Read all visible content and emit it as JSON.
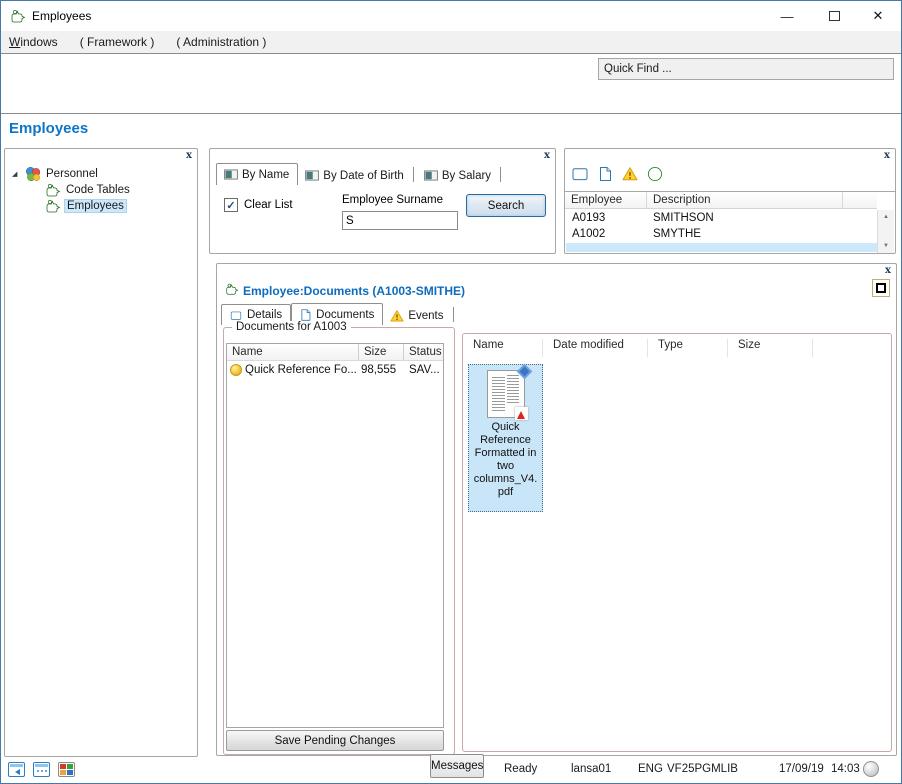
{
  "colors": {
    "accent_blue": "#0e76c8",
    "title_blue": "#0d6cbd",
    "selection_blue": "#cde8fa",
    "warning_yellow": "#ffd22e",
    "add_green": "#3fae49",
    "lansa_green": "#3e9b3e",
    "group_border": "#c9a8a8"
  },
  "title_bar": {
    "app_icon": "lansa-green-icon",
    "title": "Employees"
  },
  "window_controls": {
    "minimize_glyph": "—",
    "maximize_icon": "maximize-icon",
    "close_glyph": "✕"
  },
  "menu_bar": {
    "items": [
      "Windows",
      "( Framework )",
      "( Administration )"
    ]
  },
  "command_bar": {
    "quick_find": "Quick Find ..."
  },
  "heading": "Employees",
  "nav_tree": {
    "close_glyph": "x",
    "expander_glyph": "◢",
    "root": {
      "label": "Personnel",
      "icon": "personnel-icon"
    },
    "items": [
      {
        "label": "Code Tables",
        "icon": "lansa-green-icon"
      },
      {
        "label": "Employees",
        "icon": "lansa-green-icon",
        "selected": true
      }
    ]
  },
  "search_panel": {
    "close_glyph": "x",
    "tabs": [
      {
        "label": "By Name",
        "icon": "search-tab-icon",
        "active": true
      },
      {
        "label": "By Date of Birth",
        "icon": "search-tab-icon",
        "active": false
      },
      {
        "label": "By Salary",
        "icon": "search-tab-icon",
        "active": false
      }
    ],
    "clear_list_label": "Clear List",
    "clear_list_checked": true,
    "check_glyph": "✓",
    "surname_label": "Employee Surname",
    "surname_value": "S",
    "search_button": "Search"
  },
  "employee_panel": {
    "close_glyph": "x",
    "toolbar_icons": [
      "window-icon",
      "document-icon",
      "warning-icon",
      "add-icon"
    ],
    "grid": {
      "columns": [
        "Employee",
        "Description"
      ],
      "rows": [
        {
          "employee": "A0193",
          "description": "SMITHSON"
        },
        {
          "employee": "A1002",
          "description": "SMYTHE"
        }
      ],
      "partial_selected_row": true
    },
    "scroll_up_glyph": "▲",
    "scroll_down_glyph": "▼"
  },
  "document_panel": {
    "close_glyph": "x",
    "restore_icon": "restore-icon",
    "title_icon": "lansa-green-icon",
    "title": "Employee:Documents (A1003-SMITHE)",
    "tabs": [
      {
        "label": "Details",
        "icon": "window-icon",
        "active": false
      },
      {
        "label": "Documents",
        "icon": "document-icon",
        "active": true
      },
      {
        "label": "Events",
        "icon": "warning-icon",
        "active": false
      }
    ],
    "documents_group": {
      "title": "Documents for A1003",
      "columns": [
        "Name",
        "Size",
        "Status"
      ],
      "rows": [
        {
          "icon": "yellow-status-icon",
          "name": "Quick Reference Fo...",
          "size": "98,555",
          "status": "SAV..."
        }
      ],
      "save_button": "Save Pending Changes"
    },
    "file_view": {
      "columns": [
        "Name",
        "Date modified",
        "Type",
        "Size"
      ],
      "files": [
        {
          "icon": "pdf-thumbnail-icon",
          "selected": true,
          "name_lines": [
            "Quick",
            "Reference",
            "Formatted in",
            "two",
            "columns_V4.",
            "pdf"
          ]
        }
      ]
    }
  },
  "status_bar": {
    "window_icons": [
      "cascade-windows-icon",
      "tile-windows-icon",
      "color-grid-icon"
    ],
    "messages_button": "Messages",
    "state": "Ready",
    "server": "lansa01",
    "language": "ENG",
    "library": "VF25PGMLIB",
    "date": "17/09/19",
    "time": "14:03",
    "led_icon": "status-led-icon"
  }
}
